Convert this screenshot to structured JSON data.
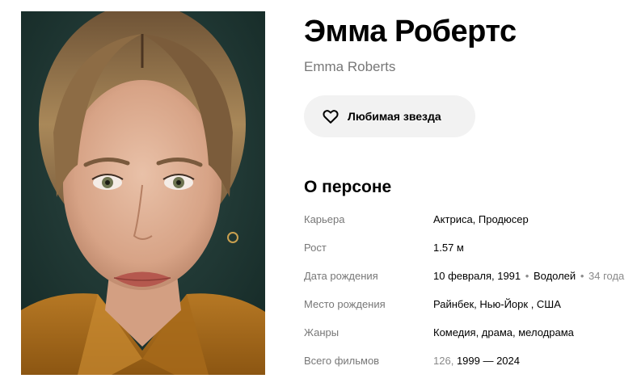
{
  "photo": {
    "alt": "Эмма Робертс",
    "background": "#1f3734"
  },
  "person": {
    "name_ru": "Эмма Робертс",
    "name_original": "Emma Roberts"
  },
  "favorite_button": {
    "label": "Любимая звезда",
    "icon": "heart-outline-icon"
  },
  "about": {
    "title": "О персоне",
    "career": {
      "label": "Карьера",
      "value": "Актриса, Продюсер"
    },
    "height": {
      "label": "Рост",
      "value": "1.57 м"
    },
    "birth_date": {
      "label": "Дата рождения",
      "date": "10 февраля, 1991",
      "bullet": "•",
      "zodiac": "Водолей",
      "age": "34 года"
    },
    "birth_place": {
      "label": "Место рождения",
      "value": "Райнбек, Нью-Йорк , США"
    },
    "genres": {
      "label": "Жанры",
      "value": "Комедия, драма, мелодрама"
    },
    "total_films": {
      "label": "Всего фильмов",
      "count": "126,",
      "years": "1999 — 2024"
    }
  }
}
